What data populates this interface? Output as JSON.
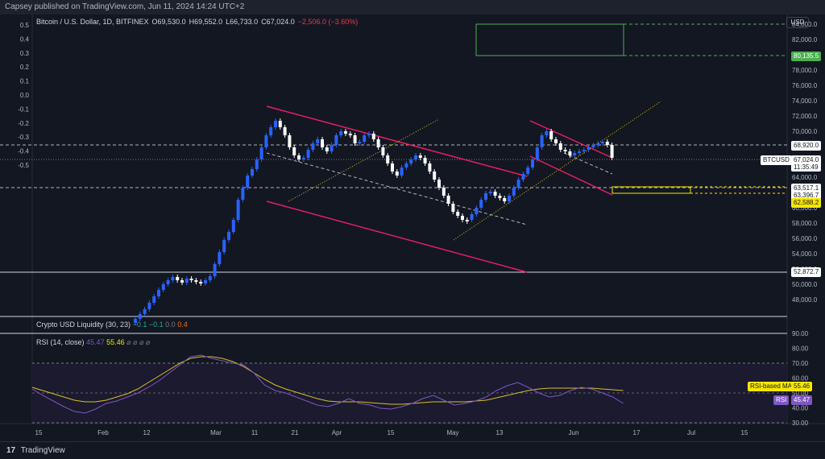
{
  "header": {
    "published": "Capsey published on TradingView.com, Jun 11, 2024 14:24 UTC+2"
  },
  "symbol": {
    "name": "Bitcoin / U.S. Dollar, 1D, BITFINEX",
    "open": "O69,530.0",
    "high": "H69,552.0",
    "low": "L66,733.0",
    "close": "C67,024.0",
    "change": "−2,506.0 (−3.60%)"
  },
  "currency": "USD",
  "price_axis": [
    "84,000.0",
    "82,000.0",
    "80,000.0",
    "78,000.0",
    "76,000.0",
    "74,000.0",
    "72,000.0",
    "70,000.0",
    "68,000.0",
    "66,000.0",
    "64,000.0",
    "62,000.0",
    "60,000.0",
    "58,000.0",
    "56,000.0",
    "54,000.0",
    "52,000.0",
    "50,000.0",
    "48,000.0"
  ],
  "left_axis": [
    "0.5",
    "0.4",
    "0.3",
    "0.2",
    "0.1",
    "0.0",
    "-0.1",
    "-0.2",
    "-0.3",
    "-0.4",
    "-0.5"
  ],
  "price_tags": {
    "target": "80,135.5",
    "resistance": "68,920.0",
    "ticker": "BTCUSD",
    "last": "67,024.0",
    "countdown": "11:35:49",
    "support1": "63,517.1",
    "support2": "63,396.7",
    "support3": "62,588.2",
    "bottom": "52,872.7"
  },
  "liquidity": {
    "title": "Crypto USD Liquidity (30, 23)",
    "v1": "−0.1",
    "v2": "−0.1",
    "v3": "0.0",
    "v4": "0.4"
  },
  "rsi": {
    "title": "RSI (14, close)",
    "value": "45.47",
    "ma_value": "55.46",
    "symbols": "⌀ ⌀ ⌀ ⌀",
    "ma_tag_label": "RSI-based MA",
    "rsi_tag_label": "RSI",
    "axis": [
      "90.00",
      "80.00",
      "70.00",
      "60.00",
      "50.00",
      "40.00",
      "30.00"
    ]
  },
  "time_axis": [
    "15",
    "Feb",
    "12",
    "Mar",
    "11",
    "21",
    "Apr",
    "15",
    "May",
    "13",
    "Jun",
    "17",
    "Jul",
    "15"
  ],
  "footer": {
    "logo": "17",
    "brand": "TradingView"
  },
  "colors": {
    "up": "#2962ff",
    "down": "#ffffff",
    "channel": "#e91e63",
    "ma": "#d4c12a",
    "rsi": "#7e57c2"
  }
}
